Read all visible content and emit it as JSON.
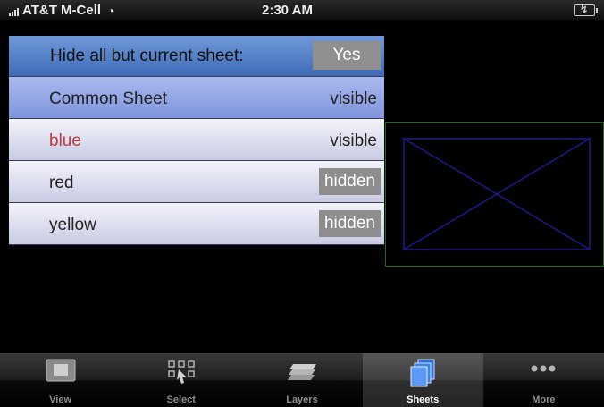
{
  "status_bar": {
    "carrier": "AT&T M-Cell",
    "time": "2:30 AM"
  },
  "sheets_panel": {
    "hide_all_label": "Hide all but current sheet:",
    "hide_all_value": "Yes",
    "rows": [
      {
        "name": "Common Sheet",
        "state": "visible"
      },
      {
        "name": "blue",
        "state": "visible"
      },
      {
        "name": "red",
        "state": "hidden"
      },
      {
        "name": "yellow",
        "state": "hidden"
      }
    ]
  },
  "tab_bar": {
    "tabs": [
      {
        "label": "View",
        "icon": "view-icon"
      },
      {
        "label": "Select",
        "icon": "select-icon"
      },
      {
        "label": "Layers",
        "icon": "layers-icon"
      },
      {
        "label": "Sheets",
        "icon": "sheets-icon"
      },
      {
        "label": "More",
        "icon": "more-icon"
      }
    ],
    "active": "Sheets"
  },
  "colors": {
    "header_blue": "#3f6cb8",
    "common_row": "#a9b9ee",
    "blue_sheet_text": "#c2363d",
    "hidden_badge": "#8d8d8d",
    "preview_border": "#1b6b1b",
    "preview_lines": "#1a1a8c"
  }
}
